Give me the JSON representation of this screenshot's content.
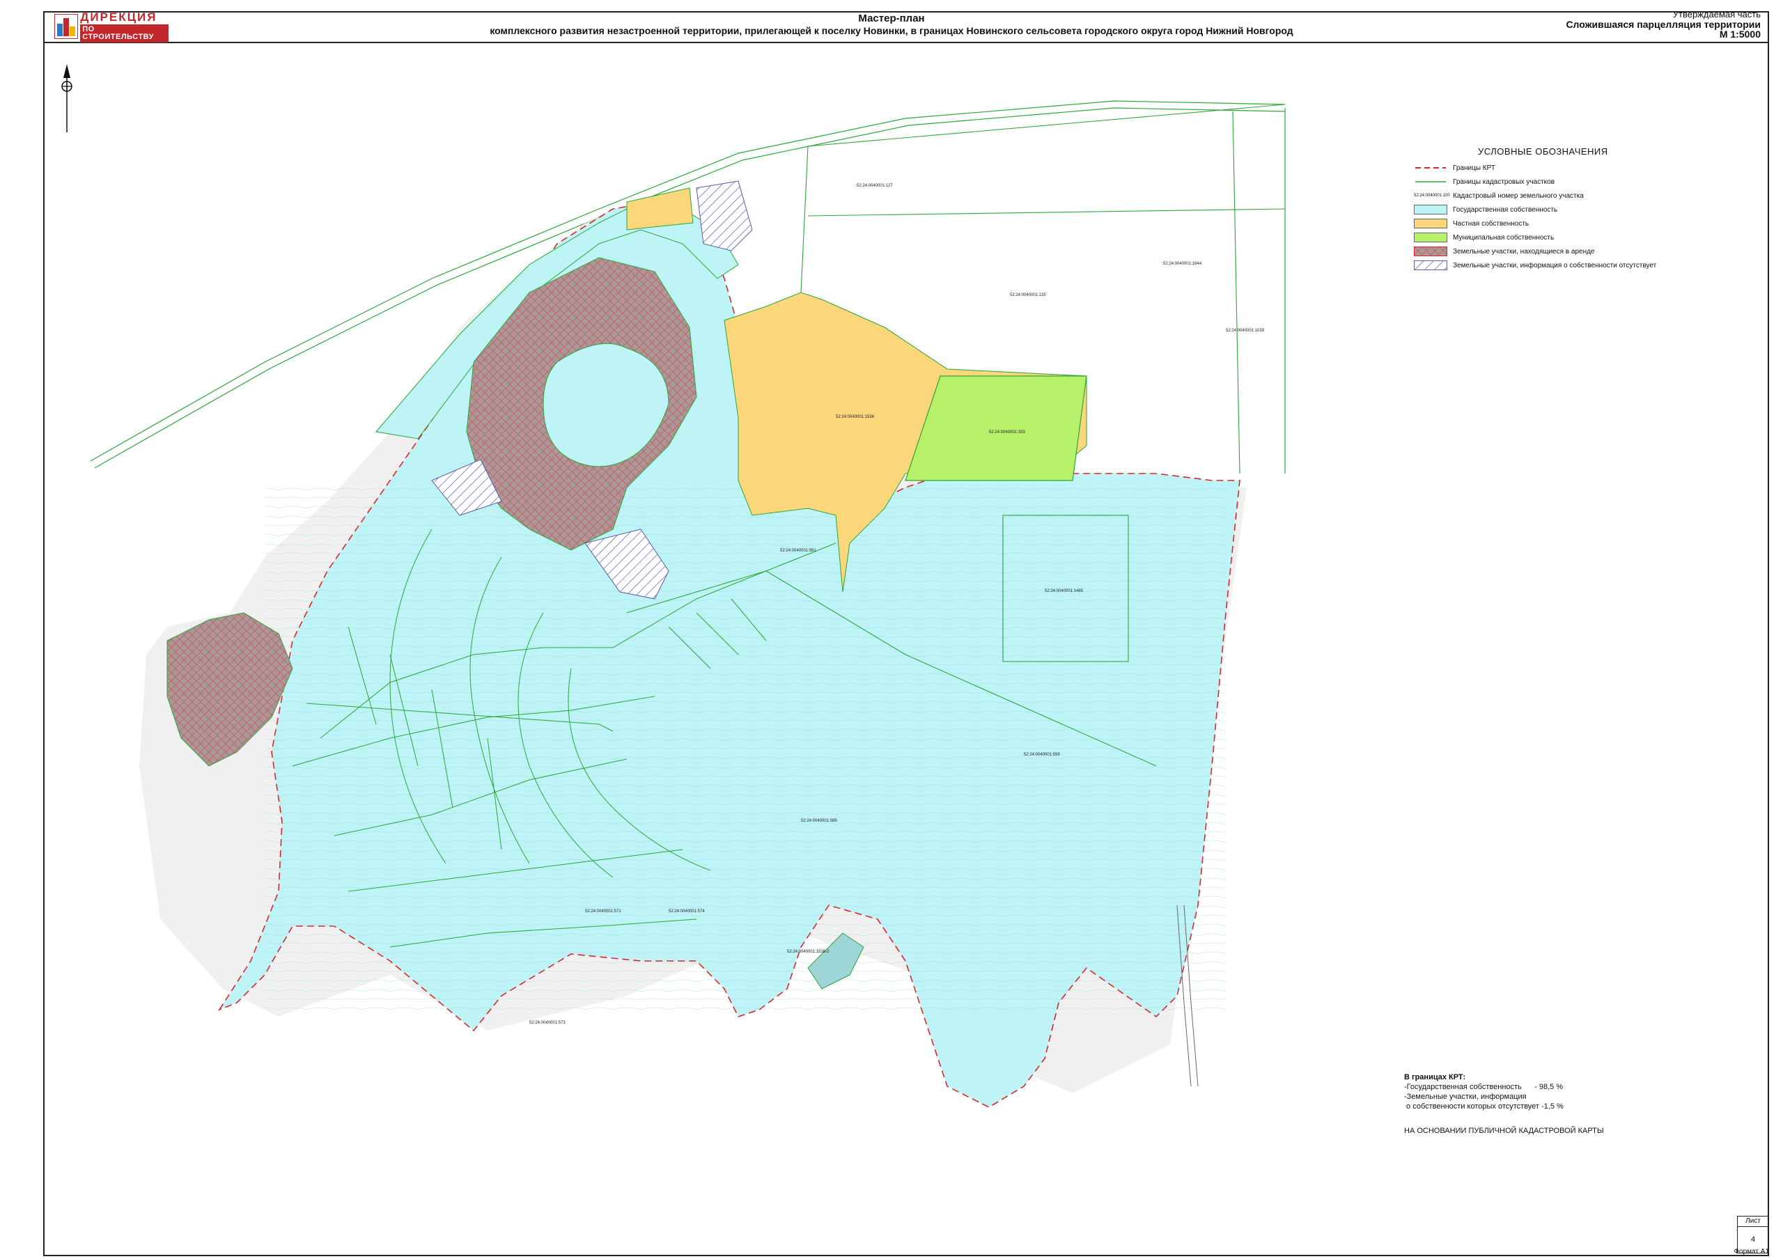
{
  "header": {
    "logo_line1": "ДИРЕКЦИЯ",
    "logo_line2": "ПО СТРОИТЕЛЬСТВУ",
    "title_line1": "Мастер-план",
    "title_line2": "комплексного развития незастроенной территории, прилегающей к поселку Новинки, в границах Новинского сельсовета городского округа город Нижний Новгород",
    "part": "Утверждаемая часть",
    "sheet_title": "Сложившаяся парцелляция территории",
    "scale": "М 1:5000"
  },
  "legend": {
    "title": "УСЛОВНЫЕ ОБОЗНАЧЕНИЯ",
    "items": [
      {
        "label": "Границы КРТ",
        "kind": "dash-red"
      },
      {
        "label": "Границы кадастровых участков",
        "kind": "line-green"
      },
      {
        "label": "Кадастровый номер земельного участка",
        "kind": "label-sample",
        "sample": "52:24:0040001:100"
      },
      {
        "label": "Государственная собственность",
        "kind": "fill",
        "color": "#bff4f6"
      },
      {
        "label": "Частная собственность",
        "kind": "fill",
        "color": "#fbd67a"
      },
      {
        "label": "Муниципальная собственность",
        "kind": "fill",
        "color": "#b7f06a"
      },
      {
        "label": "Земельные участки, находящиеся в аренде",
        "kind": "hatch-red"
      },
      {
        "label": "Земельные участки, информация о собственности отсутствует",
        "kind": "hatch-blue"
      }
    ]
  },
  "colors": {
    "state": "#bff4f6",
    "private": "#fbd67a",
    "municipal": "#b7f06a",
    "boundary_krt": "#d9262c",
    "cadastral_line": "#2aa63a",
    "lease_hatch": "#c7676a",
    "unknown_hatch": "#5a5aa8"
  },
  "stats": {
    "heading": "В границах КРТ:",
    "line1": "-Государственная собственность      - 98,5 %",
    "line2": "-Земельные участки, информация",
    "line3": " о собственности которых отсутствует -1,5 %"
  },
  "source_note": "НА ОСНОВАНИИ ПУБЛИЧНОЙ КАДАСТРОВОЙ КАРТЫ",
  "sheet": {
    "label": "Лист",
    "number": "4"
  },
  "format": "Формат А1",
  "parcel_labels": [
    "52:24:0040001:127",
    "52:24:0040001:1644",
    "52:24:0040001:135",
    "52:24:0040001:1039",
    "52:24:0040001:1536",
    "52:24:0040001:333",
    "52:24:0040001:1485",
    "52:24:0040001:599",
    "52:24:0040001:589",
    "52:24:0040001:561",
    "52:24:0040001:571",
    "52:24:0040001:573",
    "52:24:0040001:574",
    "52:24:0040001:1536-2"
  ]
}
